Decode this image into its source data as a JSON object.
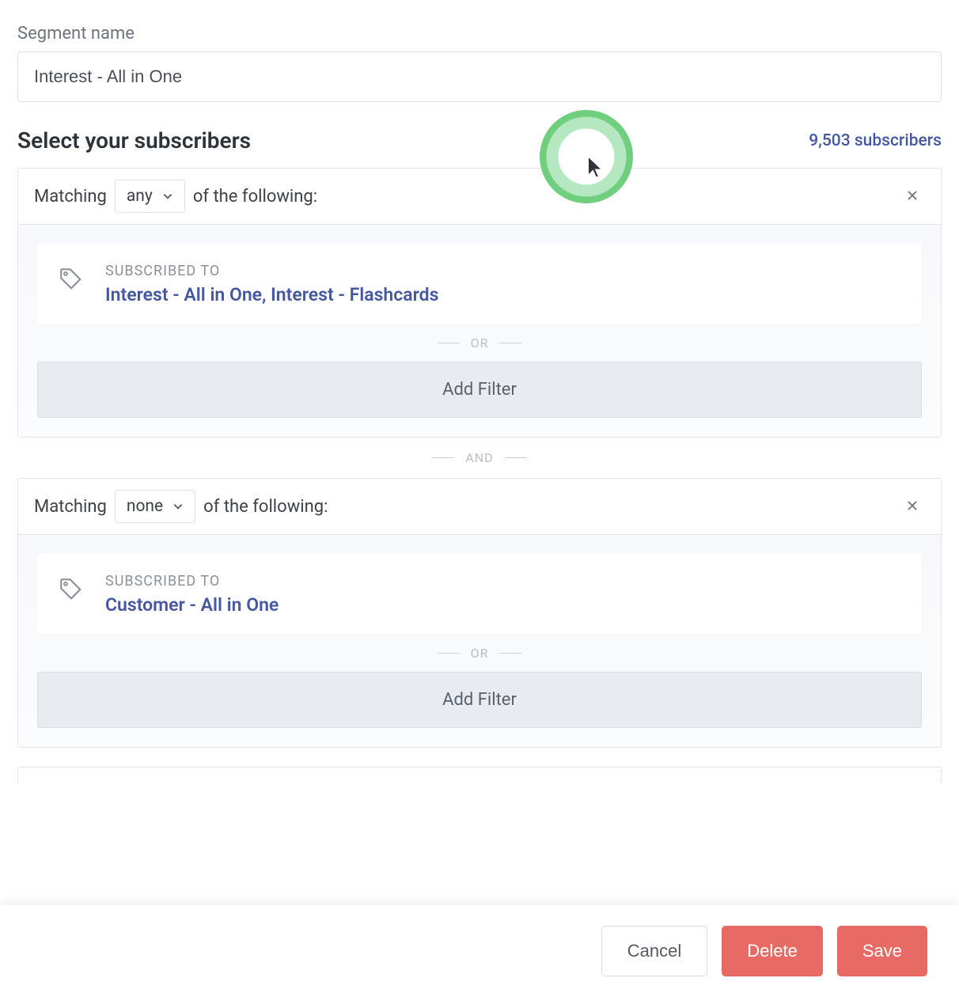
{
  "segment_name_label": "Segment name",
  "segment_name_value": "Interest - All in One",
  "subscribers_section_title": "Select your subscribers",
  "subscribers_count_text": "9,503 subscribers",
  "groups": [
    {
      "matching_prefix": "Matching",
      "matching_value": "any",
      "matching_suffix": "of the following:",
      "filter_label": "SUBSCRIBED TO",
      "filter_value": "Interest - All in One, Interest - Flashcards",
      "or_label": "OR",
      "add_filter_label": "Add Filter"
    },
    {
      "matching_prefix": "Matching",
      "matching_value": "none",
      "matching_suffix": "of the following:",
      "filter_label": "SUBSCRIBED TO",
      "filter_value": "Customer - All in One",
      "or_label": "OR",
      "add_filter_label": "Add Filter"
    }
  ],
  "and_label": "AND",
  "footer": {
    "cancel": "Cancel",
    "delete": "Delete",
    "save": "Save"
  }
}
